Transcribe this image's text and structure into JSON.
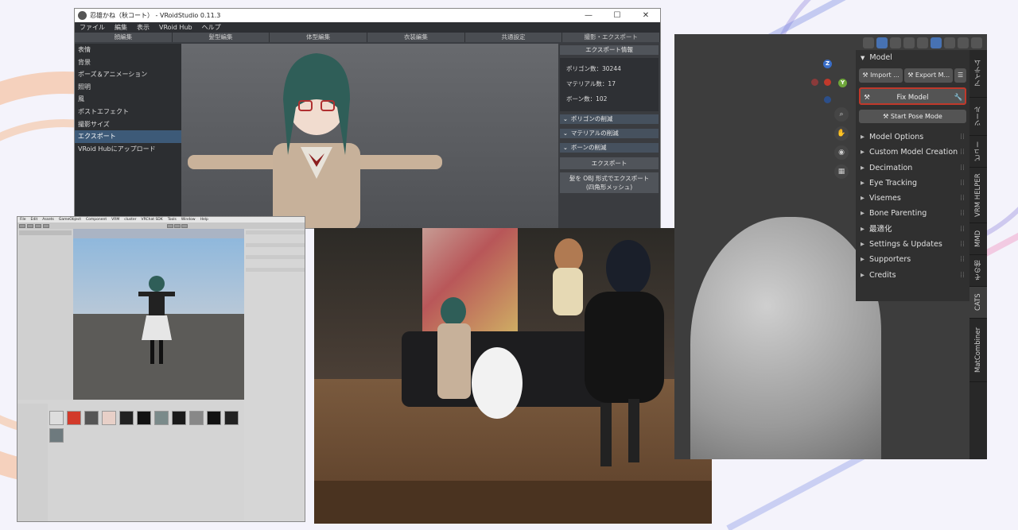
{
  "vroid": {
    "title": "忍雄かね（秋コート） - VRoidStudio 0.11.3",
    "menu": [
      "ファイル",
      "編集",
      "表示",
      "VRoid Hub",
      "ヘルプ"
    ],
    "tabs": [
      "顔編集",
      "髪型編集",
      "体型編集",
      "衣装編集",
      "共通設定",
      "撮影・エクスポート"
    ],
    "nav": [
      "表情",
      "背景",
      "ポーズ＆アニメーション",
      "照明",
      "風",
      "ポストエフェクト",
      "撮影サイズ",
      "エクスポート",
      "VRoid Hubにアップロード"
    ],
    "nav_active_index": 7,
    "export_header": "エクスポート情報",
    "info": [
      "ポリゴン数：30244",
      "マテリアル数：17",
      "ボーン数：102"
    ],
    "folds": [
      "ポリゴンの削減",
      "マテリアルの削減",
      "ボーンの削減"
    ],
    "export_button": "エクスポート",
    "obj_button_line1": "髪を OBJ 形式でエクスポート",
    "obj_button_line2": "(四角形メッシュ)"
  },
  "unity": {
    "menu": [
      "File",
      "Edit",
      "Assets",
      "GameObject",
      "Component",
      "VRM",
      "cluster",
      "VRChat SDK",
      "Tools",
      "Window",
      "Help"
    ]
  },
  "blender": {
    "model_header": "Model",
    "import_label": "Import ...",
    "export_label": "Export M...",
    "fix_model_label": "Fix Model",
    "start_pose_label": "Start Pose Mode",
    "sections": [
      "Model Options",
      "Custom Model Creation",
      "Decimation",
      "Eye Tracking",
      "Visemes",
      "Bone Parenting",
      "最適化",
      "Settings & Updates",
      "Supporters",
      "Credits"
    ],
    "side_tabs": [
      "アイテム",
      "ツール",
      "ビュー",
      "VRM HELPER",
      "MMD",
      "その他",
      "CATS",
      "MatCombiner"
    ],
    "side_tab_active": "CATS",
    "gizmo": {
      "z": "Z",
      "y": "Y"
    }
  }
}
